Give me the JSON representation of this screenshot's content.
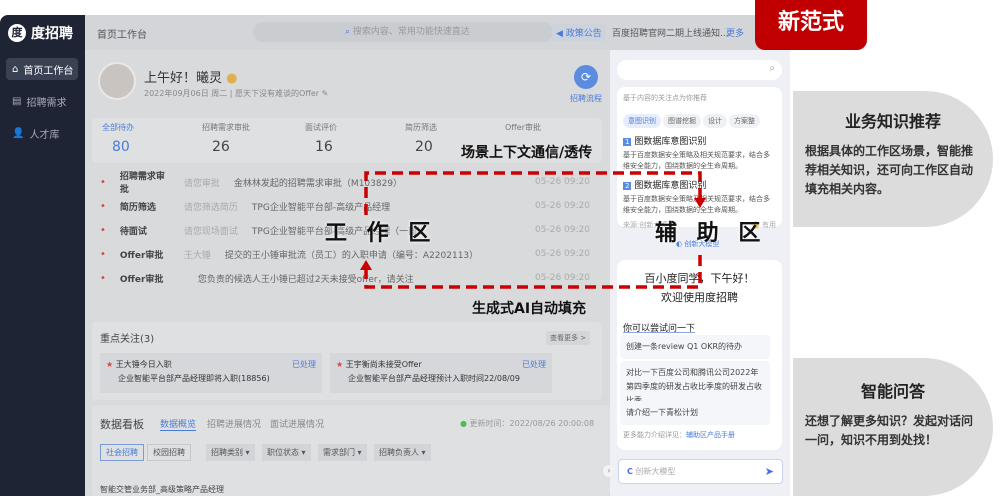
{
  "app": {
    "logo": "度招聘",
    "logo_icon": "度"
  },
  "sidebar": {
    "items": [
      {
        "label": "首页工作台",
        "icon": "home-icon"
      },
      {
        "label": "招聘需求",
        "icon": "document-icon"
      },
      {
        "label": "人才库",
        "icon": "people-icon"
      }
    ]
  },
  "header": {
    "title": "首页工作台",
    "search_placeholder": "搜索内容、常用功能快速直达",
    "notice_tag": "政策公告",
    "notice_text": "百度招聘官网二期上线通知...",
    "more": "更多"
  },
  "greeting": {
    "hello": "上午好！曦灵",
    "date": "2022年09月06日",
    "weekday": "周二",
    "motto": "愿天下没有难谈的Offer",
    "flow": "招聘流程"
  },
  "stats": [
    {
      "label": "全部待办",
      "value": "80"
    },
    {
      "label": "招聘需求审批",
      "value": "26"
    },
    {
      "label": "面试评价",
      "value": "16"
    },
    {
      "label": "简历筛选",
      "value": "20"
    },
    {
      "label": "Offer审批",
      "value": ""
    }
  ],
  "todos": [
    {
      "type": "招聘需求审批",
      "action": "请您审批",
      "desc": "金林林发起的招聘需求审批（M103829）",
      "time": "05-26 09:20"
    },
    {
      "type": "简历筛选",
      "action": "请您筛选简历",
      "desc": "TPG企业智能平台部-高级产品经理",
      "time": "05-26 09:20"
    },
    {
      "type": "待面试",
      "action": "请您现场面试",
      "desc": "TPG企业智能平台部-高级产品经理（一面）",
      "time": "05-26 09:20"
    },
    {
      "type": "Offer审批",
      "action": "王大锤",
      "desc": "提交的王小锤审批流（员工）的入职申请（编号：A2202113）",
      "time": "05-26 09:20"
    },
    {
      "type": "Offer审批",
      "action": "",
      "desc": "您负责的候选人王小锤已超过2天未接受offer，请关注",
      "time": "05-26 09:20"
    }
  ],
  "focus": {
    "title": "重点关注(3)",
    "more": "查看更多 >",
    "items": [
      {
        "title": "王大锤今日入职",
        "status": "已处理",
        "desc": "企业智能平台部产品经理即将入职(18856)"
      },
      {
        "title": "王宇衡尚未接受Offer",
        "status": "已处理",
        "desc": "企业智能平台部产品经理预计入职时间22/08/09"
      }
    ]
  },
  "board": {
    "title": "数据看板",
    "tabs": [
      "数据概览",
      "招聘进展情况",
      "面试进展情况"
    ],
    "updated": "更新时间：2022/08/26 20:00:08",
    "seg": [
      "社会招聘",
      "校园招聘"
    ],
    "filters": [
      "招聘类别 ▾",
      "职位状态 ▾",
      "需求部门 ▾",
      "招聘负责人 ▾"
    ],
    "job": "智能交管业务部_高级策略产品经理"
  },
  "assist": {
    "rec_title": "基于内容的关注点为你推荐",
    "tags": [
      "意图识别",
      "图谱挖掘",
      "设计",
      "方案整"
    ],
    "articles": [
      {
        "title": "图数据库意图识别",
        "desc": "基于百度数据安全策略及相关规范要求，结合多维安全能力，围绕数据的全生命周期。"
      },
      {
        "title": "图数据库意图识别",
        "desc": "基于百度数据安全策略及相关规范要求，结合多维安全能力，围绕数据的全生命周期。"
      }
    ],
    "source": "来源:创新大模型",
    "useful": "有用",
    "model": "创新大模型",
    "welcome1": "百小度同学，下午好！",
    "welcome2": "欢迎使用度招聘",
    "try": "你可以尝试问一下",
    "suggestions": [
      "创建一条review Q1 OKR的待办",
      "对比一下百度公司和腾讯公司2022年第四季度的研发占收比季度的研发占收比季...",
      "请介绍一下青松计划"
    ],
    "manual_prefix": "更多能力介绍详见：",
    "manual": "辅助区产品手册",
    "input_placeholder": "创新大模型"
  },
  "annotations": {
    "badge": "新范式",
    "work": "工 作 区",
    "assist": "辅 助 区",
    "context": "场景上下文通信/透传",
    "autofill": "生成式AI自动填充",
    "callout1_title": "业务知识推荐",
    "callout1_text": "根据具体的工作区场景，智能推荐相关知识，还可向工作区自动填充相关内容。",
    "callout2_title": "智能问答",
    "callout2_text": "还想了解更多知识？发起对话问一问，知识不用到处找！"
  },
  "colors": {
    "accent": "#4a7bd8",
    "badge": "#c00000",
    "dash": "#cc0000"
  }
}
